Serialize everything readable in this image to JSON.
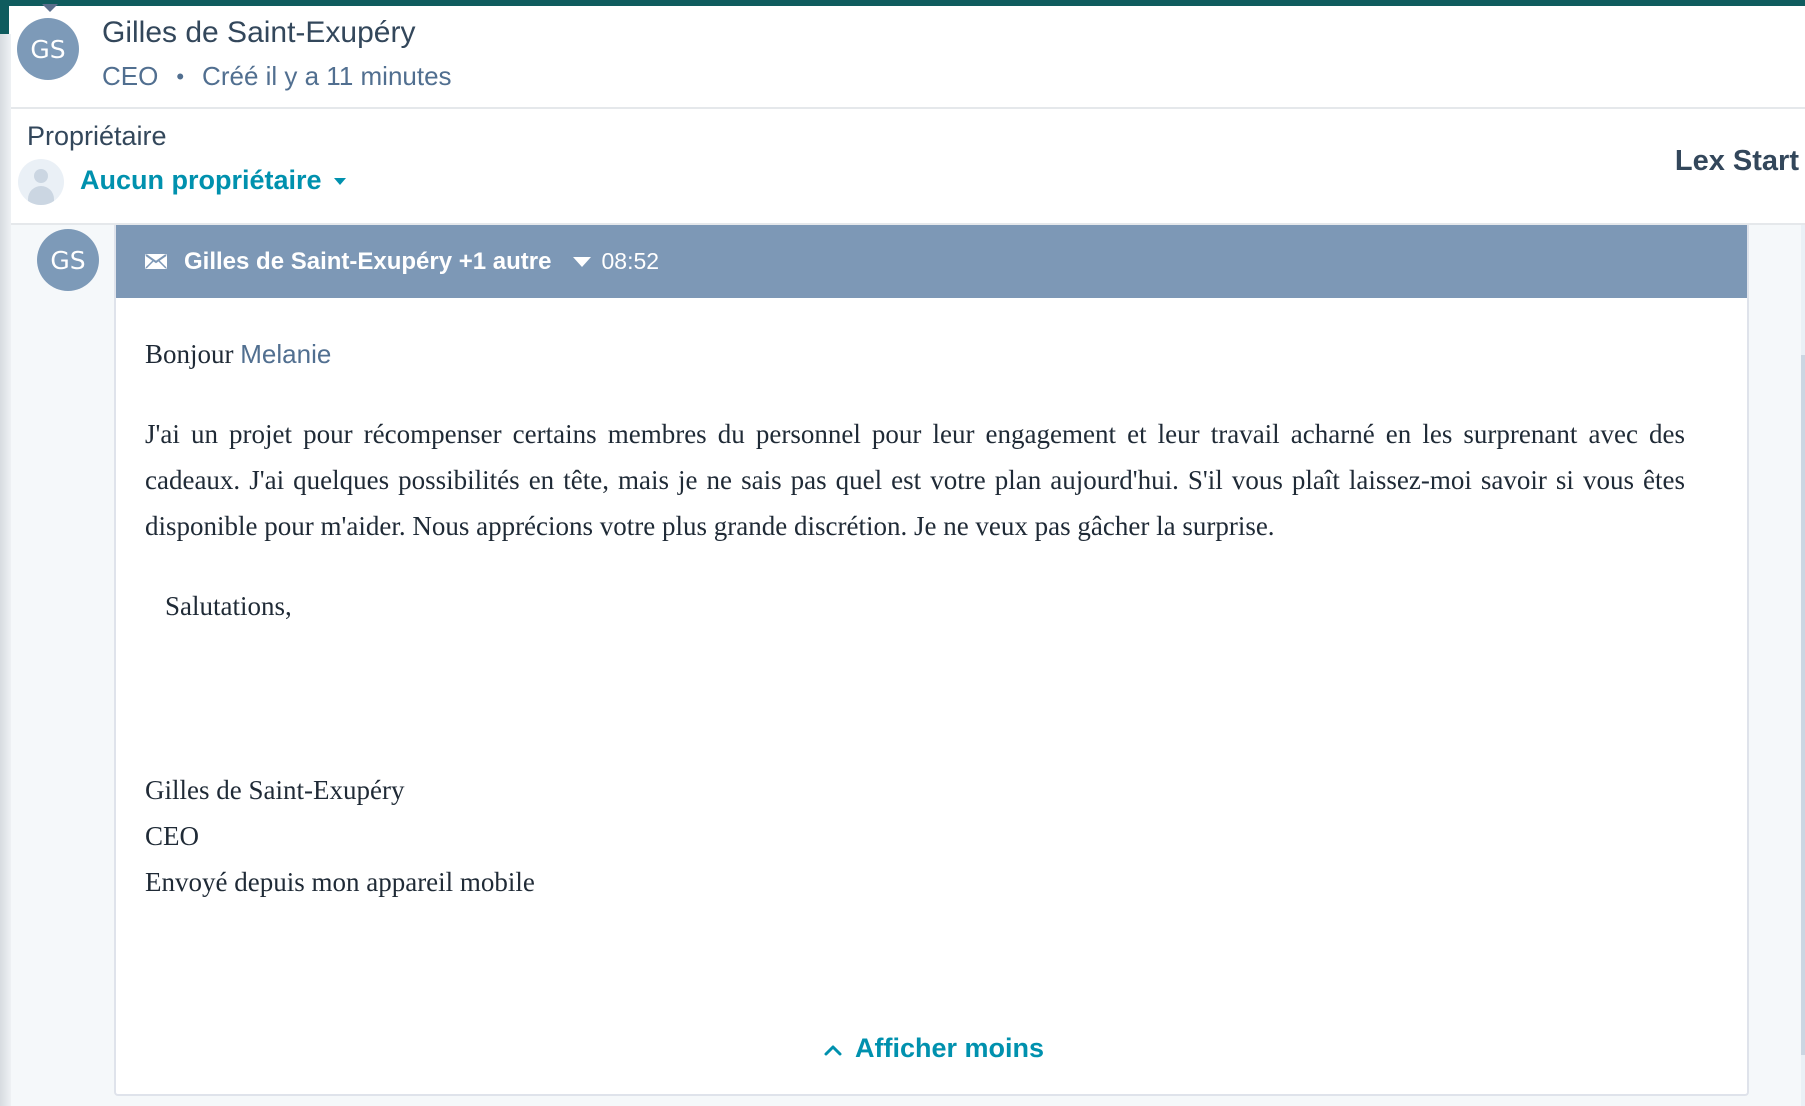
{
  "contact": {
    "initials": "GS",
    "name": "Gilles de Saint-Exupéry",
    "job_title": "CEO",
    "separator": "•",
    "created": "Créé il y a 11 minutes"
  },
  "owner": {
    "label": "Propriétaire",
    "value": "Aucun propriétaire"
  },
  "company": {
    "name": "Lex Start"
  },
  "email": {
    "avatar_initials": "GS",
    "sender": "Gilles de Saint-Exupéry +1 autre",
    "time": "08:52",
    "greeting": "Bonjour",
    "recipient_name": "Melanie",
    "body": "J'ai un projet pour récompenser certains membres du personnel pour leur engagement et leur travail acharné en les surprenant avec des cadeaux. J'ai quelques possibilités en tête, mais je ne sais pas quel est votre plan aujourd'hui. S'il vous plaît laissez-moi savoir si vous êtes disponible pour m'aider. Nous apprécions votre plus grande discrétion. Je ne veux pas gâcher la surprise.",
    "closing": "Salutations,",
    "signature": {
      "name": "Gilles de Saint-Exupéry",
      "title": "CEO",
      "footer": "Envoyé depuis mon appareil mobile"
    },
    "show_less_label": "Afficher moins"
  },
  "colors": {
    "accent_bar": "#0f5c5e",
    "avatar": "#7d9ab8",
    "email_header": "#7d98b6",
    "link": "#0091ae",
    "text": "#33475b"
  },
  "icons": {
    "mail": "envelope-icon",
    "owner_avatar": "user-placeholder-icon",
    "expand": "caret-down-icon",
    "collapse": "chevron-up-icon"
  }
}
